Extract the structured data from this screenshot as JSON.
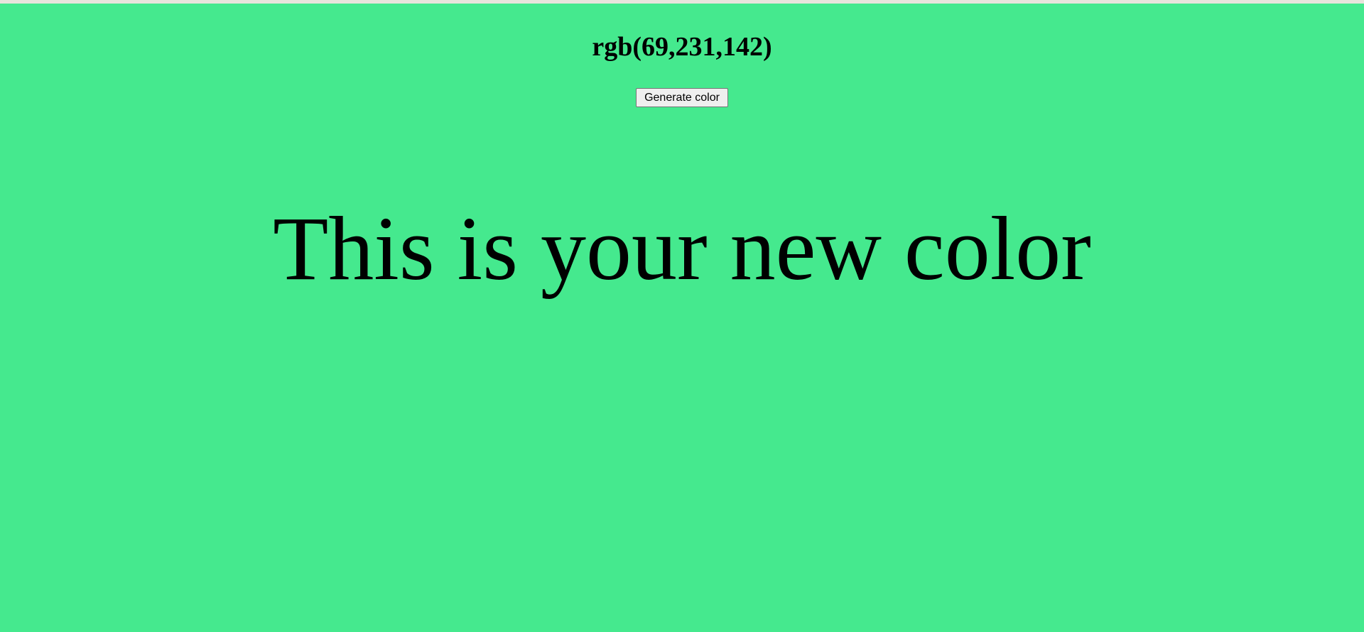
{
  "page": {
    "background_color": "#45e98e",
    "strip_color": "#e8e4dc"
  },
  "color_display": {
    "code": "rgb(69,231,142)"
  },
  "controls": {
    "generate_label": "Generate color"
  },
  "message": {
    "text": "This is your new color"
  }
}
